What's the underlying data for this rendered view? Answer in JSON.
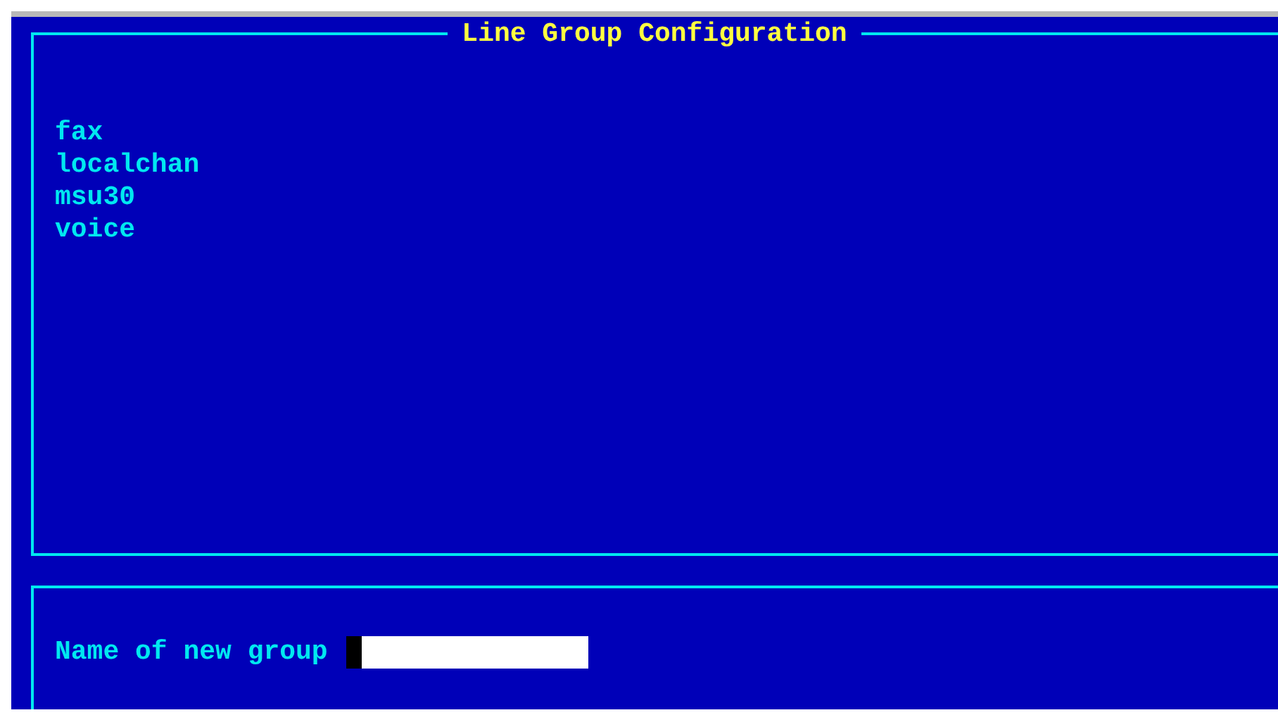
{
  "window": {
    "title": "Line Group Configuration"
  },
  "groups": [
    "fax",
    "localchan",
    "msu30",
    "voice"
  ],
  "new_group": {
    "label": "Name of new group"
  }
}
